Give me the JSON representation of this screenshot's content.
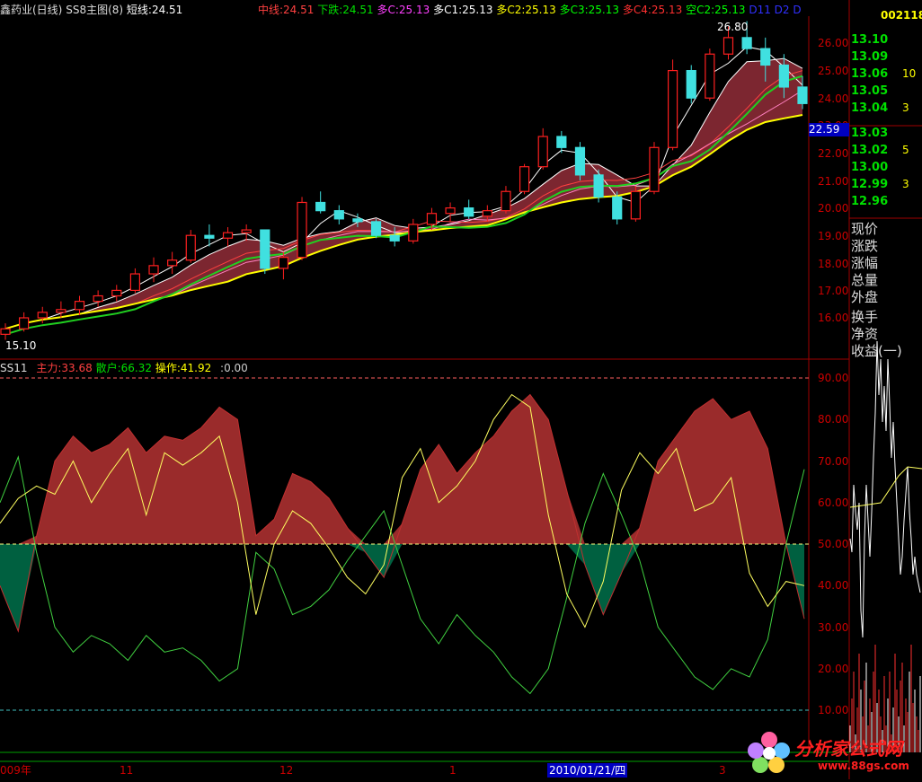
{
  "main_header": {
    "title": "鑫药业(日线)",
    "indicator": "SS8主图(8)",
    "items": [
      {
        "label": "短线:24.51",
        "color": "#ffffff"
      },
      {
        "label": "中线:24.51",
        "color": "#ff4040"
      },
      {
        "label": "下跌:24.51",
        "color": "#00e000"
      },
      {
        "label": "多C:25.13",
        "color": "#ff40ff"
      },
      {
        "label": "多C1:25.13",
        "color": "#ffffff"
      },
      {
        "label": "多C2:25.13",
        "color": "#ffff00"
      },
      {
        "label": "多C3:25.13",
        "color": "#00ff00"
      },
      {
        "label": "多C4:25.13",
        "color": "#ff3030"
      },
      {
        "label": "空C2:25.13",
        "color": "#00ff00"
      },
      {
        "label": "D11",
        "color": "#3030ff"
      },
      {
        "label": "D2",
        "color": "#3030ff"
      },
      {
        "label": "D",
        "color": "#3030ff"
      }
    ],
    "code": "002118"
  },
  "sub_header": {
    "name": "SS11",
    "items": [
      {
        "label": "主力:33.68",
        "color": "#ff4040"
      },
      {
        "label": "散户:66.32",
        "color": "#00e000"
      },
      {
        "label": "操作:41.92",
        "color": "#ffff00"
      },
      {
        "label": ":0.00",
        "color": "#cccccc"
      }
    ]
  },
  "price_axis": [
    "26.00",
    "25.00",
    "24.00",
    "23.00",
    "22.00",
    "21.00",
    "20.00",
    "19.00",
    "18.00",
    "17.00",
    "16.00"
  ],
  "current_price_tag": "22.59",
  "osc_axis": [
    "90.00",
    "80.00",
    "70.00",
    "60.00",
    "50.00",
    "40.00",
    "30.00",
    "20.00",
    "10.00"
  ],
  "markers": {
    "high": "26.80",
    "low": "15.10"
  },
  "quote_prices": [
    {
      "price": "13.10",
      "qty": ""
    },
    {
      "price": "13.09",
      "qty": ""
    },
    {
      "price": "13.06",
      "qty": "10"
    },
    {
      "price": "13.05",
      "qty": ""
    },
    {
      "price": "13.04",
      "qty": "3"
    },
    {
      "price": "13.03",
      "qty": ""
    },
    {
      "price": "13.02",
      "qty": "5"
    },
    {
      "price": "13.00",
      "qty": ""
    },
    {
      "price": "12.99",
      "qty": "3"
    },
    {
      "price": "12.96",
      "qty": ""
    }
  ],
  "quote_labels": [
    "现价",
    "涨跌",
    "涨幅",
    "总量",
    "外盘",
    "换手",
    "净资",
    "收益(一)"
  ],
  "time_axis": {
    "labels": [
      "009年",
      "11",
      "12",
      "1",
      "2010/01/21/四",
      "3"
    ]
  },
  "logo": {
    "text": "分析家公式网",
    "url_text": "www.88gs.com"
  },
  "chart_data": [
    {
      "type": "candlestick",
      "title": "SS8主图(8)",
      "ylim": [
        15.1,
        26.8
      ],
      "ohlc": [
        [
          15.4,
          15.8,
          15.2,
          15.6
        ],
        [
          15.6,
          16.2,
          15.5,
          16.0
        ],
        [
          16.0,
          16.4,
          15.8,
          16.2
        ],
        [
          16.2,
          16.6,
          16.0,
          16.3
        ],
        [
          16.3,
          16.8,
          16.1,
          16.6
        ],
        [
          16.6,
          17.0,
          16.4,
          16.8
        ],
        [
          16.8,
          17.2,
          16.6,
          17.0
        ],
        [
          17.0,
          17.8,
          16.9,
          17.6
        ],
        [
          17.6,
          18.2,
          17.3,
          17.9
        ],
        [
          17.9,
          18.4,
          17.6,
          18.1
        ],
        [
          18.1,
          19.2,
          18.0,
          19.0
        ],
        [
          19.0,
          19.4,
          18.6,
          18.9
        ],
        [
          18.9,
          19.3,
          18.6,
          19.1
        ],
        [
          19.1,
          19.4,
          18.8,
          19.2
        ],
        [
          19.2,
          19.0,
          17.6,
          17.8
        ],
        [
          17.8,
          18.4,
          17.4,
          18.2
        ],
        [
          18.2,
          20.4,
          18.1,
          20.2
        ],
        [
          20.2,
          20.6,
          19.8,
          19.9
        ],
        [
          19.9,
          20.1,
          19.4,
          19.6
        ],
        [
          19.6,
          19.8,
          19.3,
          19.5
        ],
        [
          19.5,
          19.6,
          18.9,
          19.0
        ],
        [
          19.0,
          19.3,
          18.6,
          18.8
        ],
        [
          18.8,
          19.6,
          18.7,
          19.4
        ],
        [
          19.4,
          20.0,
          19.2,
          19.8
        ],
        [
          19.8,
          20.2,
          19.5,
          20.0
        ],
        [
          20.0,
          20.3,
          19.6,
          19.7
        ],
        [
          19.7,
          20.1,
          19.5,
          19.9
        ],
        [
          19.9,
          20.8,
          19.8,
          20.6
        ],
        [
          20.6,
          21.6,
          20.5,
          21.5
        ],
        [
          21.5,
          22.9,
          21.4,
          22.6
        ],
        [
          22.6,
          22.8,
          22.0,
          22.2
        ],
        [
          22.2,
          22.4,
          21.0,
          21.2
        ],
        [
          21.2,
          21.4,
          20.2,
          20.4
        ],
        [
          20.4,
          20.6,
          19.4,
          19.6
        ],
        [
          19.6,
          20.8,
          19.5,
          20.6
        ],
        [
          20.6,
          22.4,
          20.5,
          22.2
        ],
        [
          22.2,
          25.4,
          22.1,
          25.0
        ],
        [
          25.0,
          25.2,
          23.8,
          24.0
        ],
        [
          24.0,
          25.8,
          23.9,
          25.6
        ],
        [
          25.6,
          26.6,
          25.4,
          26.2
        ],
        [
          26.2,
          26.8,
          25.6,
          25.8
        ],
        [
          25.8,
          26.2,
          24.6,
          25.2
        ],
        [
          25.2,
          25.6,
          24.0,
          24.4
        ],
        [
          24.4,
          24.8,
          23.6,
          23.8
        ]
      ]
    },
    {
      "type": "area",
      "title": "SS11",
      "ylim": [
        10,
        90
      ],
      "baseline": 50,
      "series": [
        {
          "name": "主力",
          "values": [
            40,
            29,
            52,
            70,
            76,
            72,
            74,
            78,
            72,
            76,
            75,
            78,
            83,
            80,
            52,
            56,
            67,
            65,
            61,
            54,
            48,
            42,
            55,
            68,
            74,
            67,
            72,
            76,
            82,
            86,
            80,
            63,
            45,
            33,
            43,
            54,
            70,
            76,
            82,
            85,
            80,
            82,
            73,
            50,
            32
          ]
        },
        {
          "name": "散户",
          "values": [
            60,
            71,
            48,
            30,
            24,
            28,
            26,
            22,
            28,
            24,
            25,
            22,
            17,
            20,
            48,
            44,
            33,
            35,
            39,
            46,
            52,
            58,
            45,
            32,
            26,
            33,
            28,
            24,
            18,
            14,
            20,
            37,
            55,
            67,
            57,
            46,
            30,
            24,
            18,
            15,
            20,
            18,
            27,
            50,
            68
          ]
        },
        {
          "name": "操作",
          "values": [
            55,
            61,
            64,
            62,
            70,
            60,
            67,
            73,
            57,
            72,
            69,
            72,
            76,
            60,
            33,
            50,
            58,
            55,
            49,
            42,
            38,
            45,
            66,
            73,
            60,
            64,
            70,
            80,
            86,
            83,
            57,
            38,
            30,
            41,
            63,
            72,
            67,
            73,
            58,
            60,
            66,
            43,
            35,
            41,
            40
          ]
        }
      ]
    }
  ]
}
